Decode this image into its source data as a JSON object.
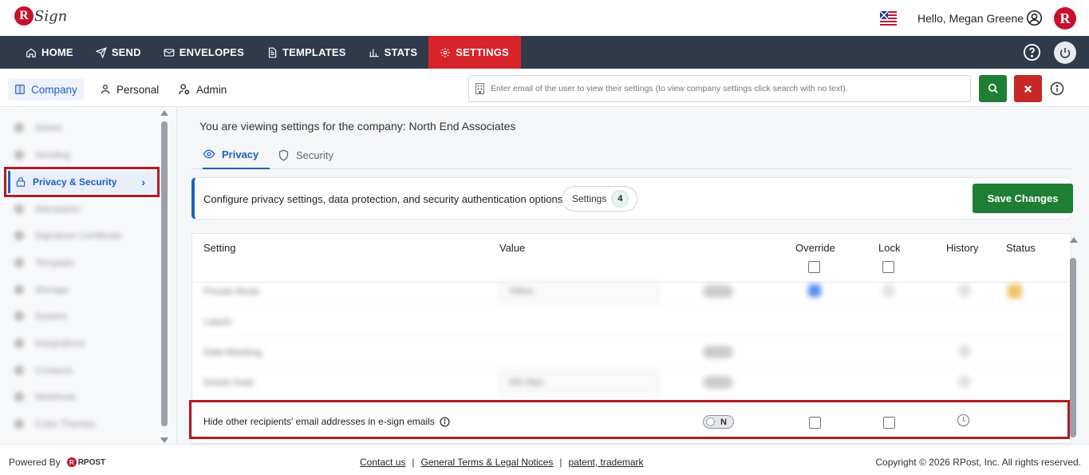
{
  "header": {
    "logo_letter": "R",
    "logo_text": "Sign",
    "greeting": "Hello, Megan Greene"
  },
  "nav": {
    "items": [
      {
        "label": "HOME",
        "icon": "home-icon"
      },
      {
        "label": "SEND",
        "icon": "send-icon"
      },
      {
        "label": "ENVELOPES",
        "icon": "envelope-icon"
      },
      {
        "label": "TEMPLATES",
        "icon": "template-icon"
      },
      {
        "label": "STATS",
        "icon": "stats-icon"
      },
      {
        "label": "SETTINGS",
        "icon": "gear-icon",
        "active": true
      }
    ]
  },
  "subtabs": {
    "company": "Company",
    "personal": "Personal",
    "admin": "Admin"
  },
  "search": {
    "placeholder": "Enter email of the user to view their settings (to view company settings click search with no text)."
  },
  "sidebar": {
    "active_label": "Privacy & Security",
    "active_chevron": "›",
    "blurred_items": [
      "Admin",
      "Sending",
      "Attestation",
      "Signature Certificate",
      "Template",
      "Storage",
      "System",
      "Integrations",
      "Contacts",
      "Webhook",
      "Color Themes"
    ]
  },
  "main": {
    "viewing_text": "You are viewing settings for the company: North End Associates",
    "tabs": {
      "privacy": "Privacy",
      "security": "Security"
    },
    "config_text": "Configure privacy settings, data protection, and security authentication options.",
    "settings_label": "Settings",
    "settings_count": "4",
    "save_label": "Save Changes"
  },
  "table": {
    "headers": {
      "setting": "Setting",
      "value": "Value",
      "override": "Override",
      "lock": "Lock",
      "history": "History",
      "status": "Status"
    },
    "blurred_rows": [
      "Private Mode",
      "Labels",
      "Data Masking",
      "Delete Data"
    ],
    "blurred_values": [
      "Yellow",
      "180 days"
    ],
    "highlighted_row": {
      "label": "Hide other recipients' email addresses in e-sign emails",
      "toggle_value": "N"
    }
  },
  "footer": {
    "powered_by": "Powered By",
    "brand": "RPOST",
    "links": [
      "Contact us",
      "General Terms & Legal Notices",
      "patent, trademark"
    ],
    "separator": "|",
    "copyright": "Copyright © 2026 RPost, Inc. All rights reserved."
  },
  "colors": {
    "nav_bg": "#2f3a4a",
    "active_nav": "#d8232a",
    "primary_blue": "#1f5fbf",
    "save_green": "#1e7e34",
    "clear_red": "#c62828",
    "highlight_border": "#b01c22"
  }
}
